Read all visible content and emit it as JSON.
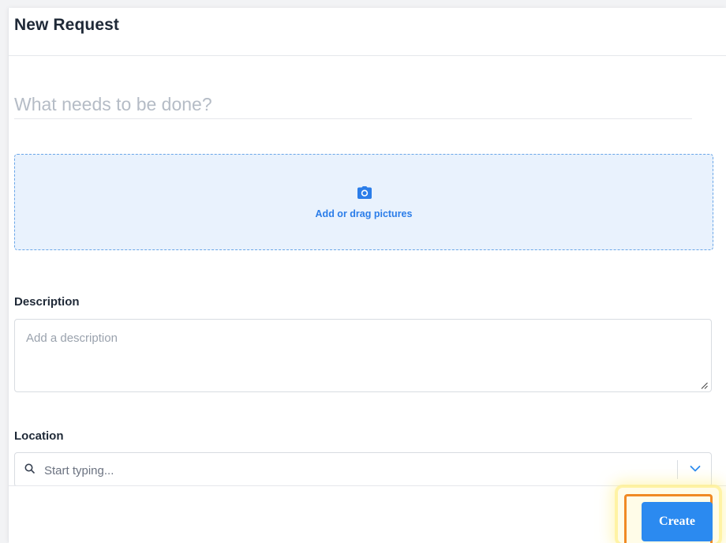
{
  "header": {
    "title": "New Request"
  },
  "title_field": {
    "placeholder": "What needs to be done?"
  },
  "dropzone": {
    "label": "Add or drag pictures",
    "icon": "camera-icon"
  },
  "description": {
    "label": "Description",
    "placeholder": "Add a description"
  },
  "location": {
    "label": "Location",
    "placeholder": "Start typing...",
    "icon": "search-icon"
  },
  "footer": {
    "create_label": "Create"
  },
  "colors": {
    "accent": "#2b8af0",
    "dropzone_bg": "#e9f2fd",
    "highlight_border": "#f08a24"
  }
}
